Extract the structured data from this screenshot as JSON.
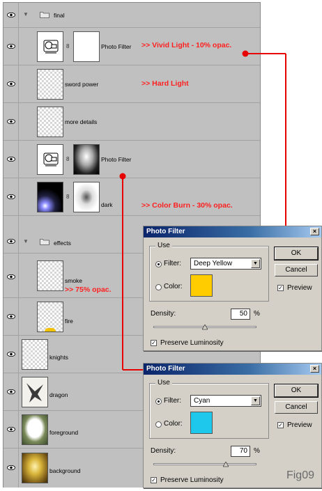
{
  "layers": [
    {
      "name": "final",
      "type": "group",
      "annotation": ""
    },
    {
      "name": "Photo Filter",
      "type": "adjustment",
      "annotation": ">> Vivid Light - 10% opac."
    },
    {
      "name": "sword power",
      "type": "layer",
      "annotation": ">> Hard Light"
    },
    {
      "name": "more details",
      "type": "layer",
      "annotation": ""
    },
    {
      "name": "Photo Filter",
      "type": "adjustment",
      "annotation": ""
    },
    {
      "name": "dark",
      "type": "layer",
      "annotation": ">> Color Burn - 30% opac."
    },
    {
      "name": "effects",
      "type": "group",
      "annotation": ""
    },
    {
      "name": "smoke",
      "type": "layer",
      "annotation": ">> 75% opac."
    },
    {
      "name": "fire",
      "type": "layer",
      "annotation": ""
    },
    {
      "name": "knights",
      "type": "layer",
      "annotation": ""
    },
    {
      "name": "dragon",
      "type": "layer",
      "annotation": ""
    },
    {
      "name": "foreground",
      "type": "layer",
      "annotation": ""
    },
    {
      "name": "background",
      "type": "layer",
      "annotation": ""
    }
  ],
  "dialogs": [
    {
      "title": "Photo Filter",
      "use_label": "Use",
      "filter_label": "Filter:",
      "filter_value": "Deep Yellow",
      "color_label": "Color:",
      "color_swatch": "#ffcc00",
      "density_label": "Density:",
      "density_value": "50",
      "density_unit": "%",
      "density_level": 0.5,
      "preserve_label": "Preserve Luminosity",
      "ok_label": "OK",
      "cancel_label": "Cancel",
      "preview_label": "Preview",
      "close_label": "×"
    },
    {
      "title": "Photo Filter",
      "use_label": "Use",
      "filter_label": "Filter:",
      "filter_value": "Cyan",
      "color_label": "Color:",
      "color_swatch": "#1ec8ec",
      "density_label": "Density:",
      "density_value": "70",
      "density_unit": "%",
      "density_level": 0.7,
      "preserve_label": "Preserve Luminosity",
      "ok_label": "OK",
      "cancel_label": "Cancel",
      "preview_label": "Preview",
      "close_label": "×"
    }
  ],
  "figure_label": "Fig09",
  "colors": {
    "annotation": "#ff1f1f",
    "callout_line": "#e60000",
    "titlebar": "#0a246a"
  }
}
